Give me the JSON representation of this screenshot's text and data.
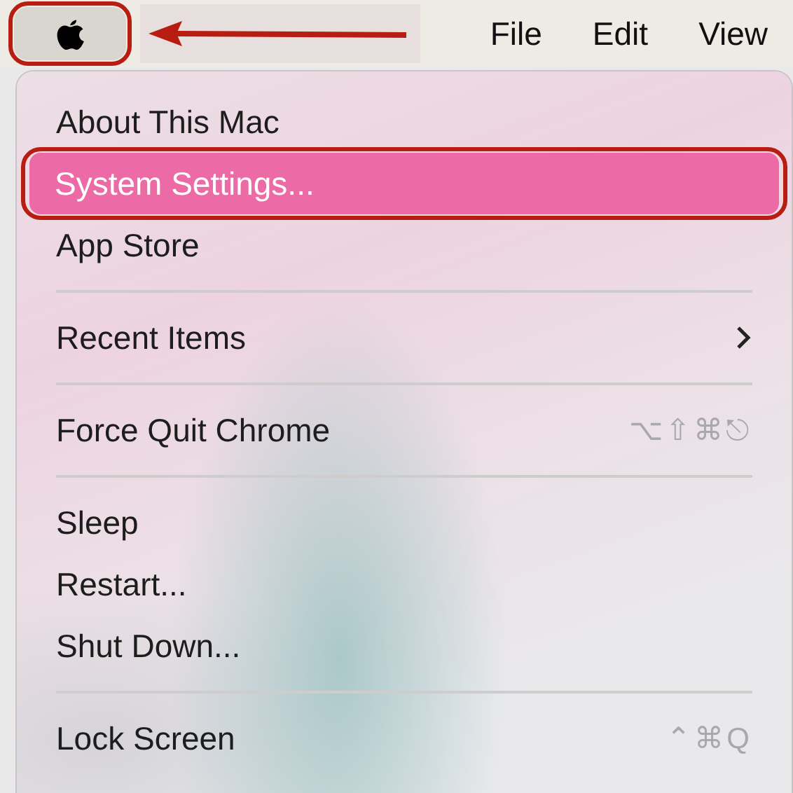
{
  "menu_bar": {
    "apple_menu": {
      "selected": true,
      "annotated": true
    },
    "annotation_arrow": true,
    "menus": [
      {
        "label": "File"
      },
      {
        "label": "Edit"
      },
      {
        "label": "View"
      }
    ]
  },
  "menu": {
    "items": [
      {
        "kind": "item",
        "label": "About This Mac",
        "selected": false
      },
      {
        "kind": "item",
        "label": "System Settings...",
        "selected": true,
        "annotated": true
      },
      {
        "kind": "item",
        "label": "App Store",
        "selected": false
      },
      {
        "kind": "separator"
      },
      {
        "kind": "item",
        "label": "Recent Items",
        "selected": false,
        "submenu": true
      },
      {
        "kind": "separator"
      },
      {
        "kind": "item",
        "label": "Force Quit Chrome",
        "selected": false,
        "shortcut": "⌥⇧⌘⎋"
      },
      {
        "kind": "separator"
      },
      {
        "kind": "item",
        "label": "Sleep",
        "selected": false
      },
      {
        "kind": "item",
        "label": "Restart...",
        "selected": false
      },
      {
        "kind": "item",
        "label": "Shut Down...",
        "selected": false
      },
      {
        "kind": "separator"
      },
      {
        "kind": "item",
        "label": "Lock Screen",
        "selected": false,
        "shortcut": "⌃⌘Q"
      }
    ]
  }
}
